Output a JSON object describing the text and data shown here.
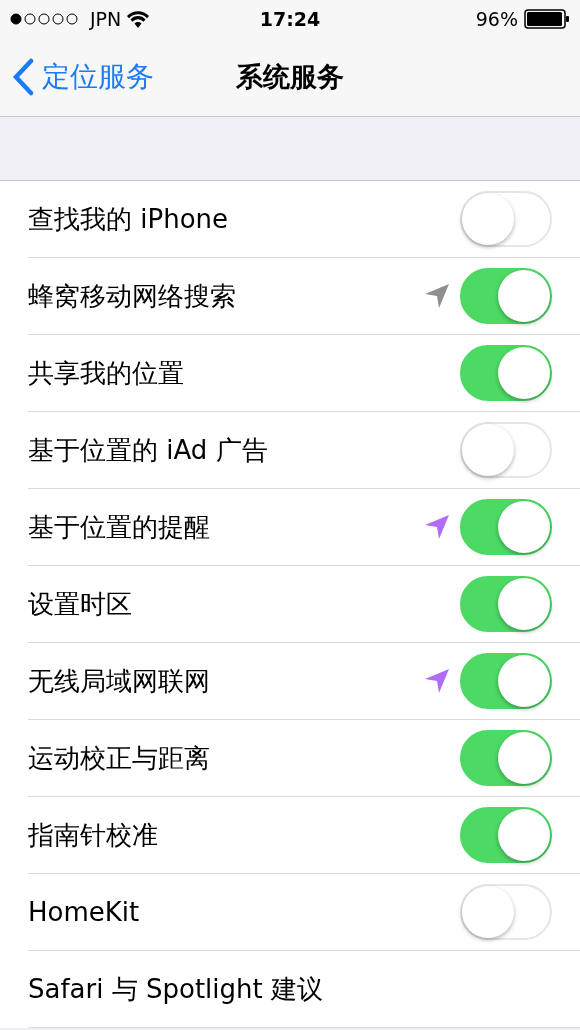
{
  "status_bar": {
    "carrier": "JPN",
    "time": "17:24",
    "battery": "96%"
  },
  "nav": {
    "back": "定位服务",
    "title": "系统服务"
  },
  "rows": [
    {
      "label": "查找我的 iPhone",
      "on": false
    },
    {
      "label": "蜂窝移动网络搜索",
      "on": true,
      "color": "#8e8e93"
    },
    {
      "label": "共享我的位置",
      "on": true
    },
    {
      "label": "基于位置的 iAd 广告",
      "on": false
    },
    {
      "label": "基于位置的提醒",
      "on": true,
      "color": "#b36cf5"
    },
    {
      "label": "设置时区",
      "on": true
    },
    {
      "label": "无线局域网联网",
      "on": true,
      "color": "#b36cf5"
    },
    {
      "label": "运动校正与距离",
      "on": true
    },
    {
      "label": "指南针校准",
      "on": true
    },
    {
      "label": "HomeKit",
      "on": false
    },
    {
      "label": "Safari 与 Spotlight 建议"
    }
  ]
}
